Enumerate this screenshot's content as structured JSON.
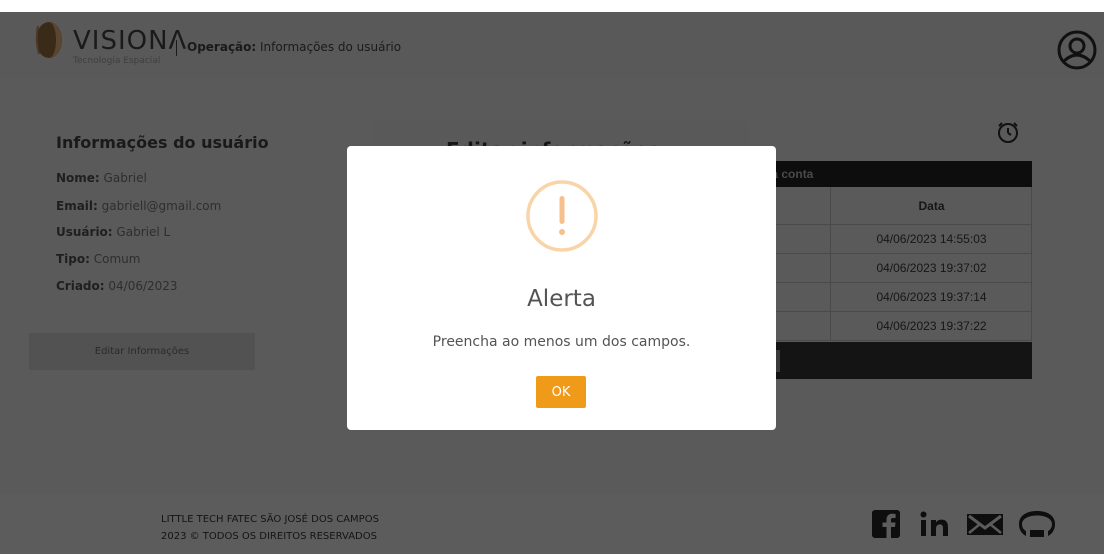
{
  "header": {
    "brand_name": "VISIONΛ",
    "brand_sub": "Tecnologia Espacial",
    "operation_label": "Operação:",
    "operation_value": " Informações do usuário"
  },
  "user_info": {
    "title": "Informações do usuário",
    "fields": [
      {
        "label": "Nome:",
        "value": " Gabriel"
      },
      {
        "label": "Email:",
        "value": " gabriell@gmail.com"
      },
      {
        "label": "Usuário:",
        "value": " Gabriel L"
      },
      {
        "label": "Tipo:",
        "value": " Comum"
      },
      {
        "label": "Criado:",
        "value": " 04/06/2023"
      }
    ],
    "edit_button": "Editar Informações"
  },
  "edit_panel": {
    "title": "Editar informações"
  },
  "history": {
    "header_partial": "ies da conta",
    "column_data": "Data",
    "rows": [
      "04/06/2023 14:55:03",
      "04/06/2023 19:37:02",
      "04/06/2023 19:37:14",
      "04/06/2023 19:37:22"
    ]
  },
  "footer": {
    "line1": "LITTLE TECH FATEC SÃO JOSÉ DOS CAMPOS",
    "line2": "2023 © TODOS OS DIREITOS RESERVADOS",
    "social_icons": [
      "facebook-icon",
      "linkedin-icon",
      "mail-icon",
      "github-icon"
    ]
  },
  "modal": {
    "title": "Alerta",
    "message": "Preencha ao menos um dos campos.",
    "ok_label": "OK",
    "accent_color": "#f09a1a",
    "icon_color": "#f8d4a8"
  }
}
